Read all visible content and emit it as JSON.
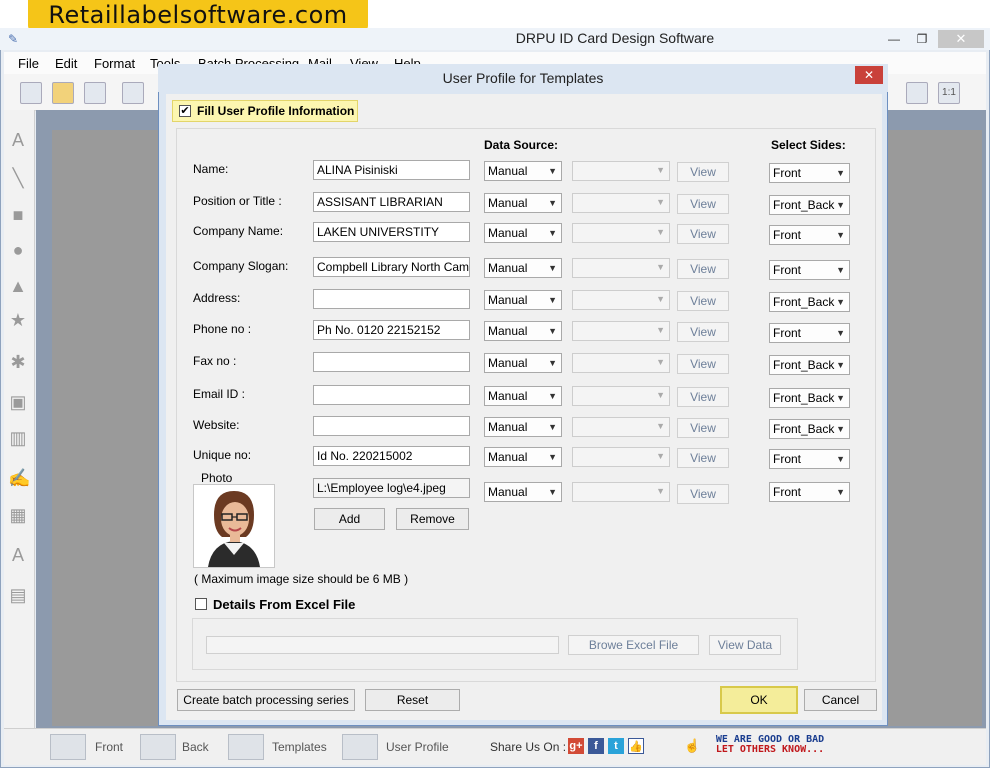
{
  "banner": {
    "text": "Retaillabelsoftware.com"
  },
  "window": {
    "title": "DRPU ID Card Design Software",
    "minimize": "—",
    "restore": "❐",
    "close": "✕"
  },
  "menu": [
    "File",
    "Edit",
    "Format",
    "Tools",
    "Batch Processing",
    "Mail",
    "View",
    "Help"
  ],
  "dialog": {
    "title": "User Profile for Templates",
    "close": "✕",
    "fill_checkbox": {
      "label": "Fill User Profile Information",
      "checked": true
    },
    "headers": {
      "data_source": "Data Source:",
      "select_sides": "Select Sides:"
    },
    "view_label": "View",
    "rows": [
      {
        "label": "Name:",
        "value": "ALINA Pisiniski",
        "source": "Manual",
        "side": "Front"
      },
      {
        "label": "Position or Title :",
        "value": "ASSISANT LIBRARIAN",
        "source": "Manual",
        "side": "Front_Back"
      },
      {
        "label": "Company Name:",
        "value": "LAKEN UNIVERSTITY",
        "source": "Manual",
        "side": "Front"
      },
      {
        "label": "Company Slogan:",
        "value": "Compbell Library     North Campu",
        "source": "Manual",
        "side": "Front"
      },
      {
        "label": "Address:",
        "value": "",
        "source": "Manual",
        "side": "Front_Back"
      },
      {
        "label": "Phone no :",
        "value": "Ph No. 0120 22152152",
        "source": "Manual",
        "side": "Front"
      },
      {
        "label": "Fax no :",
        "value": "",
        "source": "Manual",
        "side": "Front_Back"
      },
      {
        "label": "Email ID :",
        "value": "",
        "source": "Manual",
        "side": "Front_Back"
      },
      {
        "label": "Website:",
        "value": "",
        "source": "Manual",
        "side": "Front_Back"
      },
      {
        "label": "Unique no:",
        "value": "Id No. 220215002",
        "source": "Manual",
        "side": "Front"
      }
    ],
    "photo": {
      "label": "Photo",
      "path": "L:\\Employee log\\e4.jpeg",
      "source": "Manual",
      "side": "Front",
      "add": "Add",
      "remove": "Remove",
      "note": "( Maximum image size should be 6 MB )"
    },
    "excel": {
      "label": "Details From Excel File",
      "checked": false,
      "browse": "Browe Excel File",
      "view_data": "View Data"
    },
    "buttons": {
      "batch": "Create batch processing series",
      "reset": "Reset",
      "ok": "OK",
      "cancel": "Cancel"
    }
  },
  "bottom_tabs": [
    "Front",
    "Back",
    "Templates",
    "User Profile"
  ],
  "share": {
    "label": "Share Us On :",
    "icons": [
      "google-plus-icon",
      "facebook-icon",
      "twitter-icon",
      "like-icon"
    ]
  },
  "feedback": {
    "line1": "WE ARE GOOD OR BAD",
    "line2": "LET OTHERS KNOW..."
  },
  "colors": {
    "accent_yellow": "#f5c518",
    "highlight": "#fcf6b0",
    "dialog_frame": "#dce6f2"
  }
}
